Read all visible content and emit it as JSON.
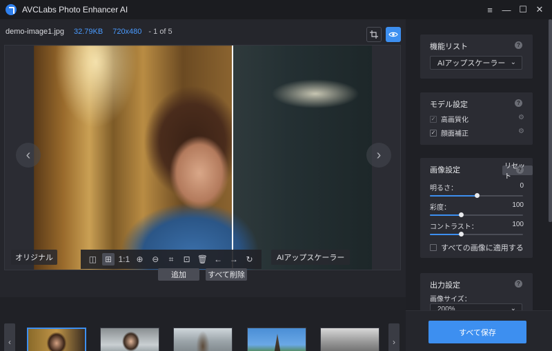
{
  "app": {
    "title": "AVCLabs Photo Enhancer AI"
  },
  "window_controls": {
    "menu": "≡",
    "minimize": "—",
    "maximize": "☐",
    "close": "✕"
  },
  "file": {
    "name": "demo-image1.jpg",
    "size": "32.79KB",
    "dimensions": "720x480",
    "index": "- 1 of 5"
  },
  "viewer": {
    "label_original": "オリジナル",
    "label_ai": "AIアップスケーラー",
    "prev": "‹",
    "next": "›",
    "toolbar": {
      "split": "◫",
      "grid": "⊞",
      "ratio": "1:1",
      "zoom_in": "⊕",
      "zoom_out": "⊖",
      "crop": "⌗",
      "save": "⊡",
      "delete": "🗑",
      "undo": "←",
      "redo": "→",
      "rotate": "↻"
    }
  },
  "actions": {
    "add": "追加",
    "delete_all": "すべて削除"
  },
  "strip": {
    "prev": "‹",
    "next": "›"
  },
  "panel": {
    "feature_list": {
      "title": "機能リスト",
      "selected": "AIアップスケーラー"
    },
    "model_settings": {
      "title": "モデル設定",
      "items": [
        {
          "label": "高画質化",
          "checked": "✓"
        },
        {
          "label": "顔面補正",
          "checked": "✓"
        }
      ]
    },
    "image_settings": {
      "title": "画像設定",
      "reset": "リセット",
      "sliders": [
        {
          "label": "明るさ：",
          "value": "0",
          "fraction": 0.5
        },
        {
          "label": "彩度：",
          "value": "100",
          "fraction": 0.33
        },
        {
          "label": "コントラスト：",
          "value": "100",
          "fraction": 0.33
        }
      ],
      "apply_all": "すべての画像に適用する"
    },
    "output_settings": {
      "title": "出力設定",
      "size_label": "画像サイズ：",
      "size_value": "200%"
    },
    "save_all": "すべて保存"
  },
  "colors": {
    "accent": "#3d8ff0",
    "background": "#1e1f24",
    "panel": "#2b2c33"
  }
}
